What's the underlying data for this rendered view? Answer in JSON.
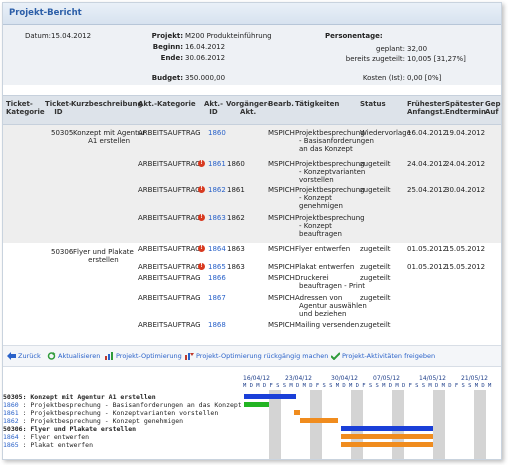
{
  "window": {
    "title": "Projekt-Bericht"
  },
  "summary": {
    "datum_label": "Datum:",
    "datum_value": "15.04.2012",
    "projekt_label": "Projekt:",
    "projekt_value": "M200 Produkteinführung",
    "beginn_label": "Beginn:",
    "beginn_value": "16.04.2012",
    "ende_label": "Ende:",
    "ende_value": "30.06.2012",
    "budget_label": "Budget:",
    "budget_value": "350.000,00",
    "personentage_label": "Personentage:",
    "geplant_label": "geplant:",
    "geplant_value": "32,00",
    "zugeteilt_label": "bereits zugeteilt:",
    "zugeteilt_value": "10,005 [31,27%]",
    "kosten_label": "Kosten (Ist):",
    "kosten_value": "0,00 [0%]"
  },
  "table": {
    "headers": {
      "ticket_kategorie_1": "Ticket-",
      "ticket_kategorie_2": "Kategorie",
      "ticket_id_1": "Ticket-",
      "ticket_id_2": "ID",
      "kurzbeschreibung": "Kurzbeschreibung",
      "akt_kategorie": "Akt.-Kategorie",
      "akt_id_1": "Akt.-",
      "akt_id_2": "ID",
      "vorgaenger_1": "Vorgänger-",
      "vorgaenger_2": "Akt.",
      "bearb": "Bearb.",
      "taetigkeiten": "Tätigkeiten",
      "status": "Status",
      "fruehester_1": "Frühester",
      "fruehester_2": "Anfangst.",
      "spaetester_1": "Spätester",
      "spaetester_2": "Endtermin",
      "gep_1": "Gep",
      "gep_2": "Auf"
    },
    "tickets": [
      {
        "id": "50305",
        "desc_1": "Konzept mit Agentur",
        "desc_2": "A1 erstellen"
      },
      {
        "id": "50306",
        "desc_1": "Flyer und Plakate",
        "desc_2": "erstellen"
      }
    ],
    "rows": [
      {
        "kat": "ARBEITSAUFTRAG",
        "warn": false,
        "akt": "1860",
        "vor": "",
        "bearb": "MSPICH",
        "t1": "Projektbesprechung",
        "t2": "- Basisanforderungen",
        "t3": "an das Konzept",
        "status": "Wiedervorlage",
        "start": "16.04.2012",
        "end": "19.04.2012"
      },
      {
        "kat": "ARBEITSAUFTRAG",
        "warn": true,
        "akt": "1861",
        "vor": "1860",
        "bearb": "MSPICH",
        "t1": "Projektbesprechung",
        "t2": "- Konzeptvarianten",
        "t3": "vorstellen",
        "status": "zugeteilt",
        "start": "24.04.2012",
        "end": "24.04.2012"
      },
      {
        "kat": "ARBEITSAUFTRAG",
        "warn": true,
        "akt": "1862",
        "vor": "1861",
        "bearb": "MSPICH",
        "t1": "Projektbesprechung",
        "t2": "- Konzept",
        "t3": "genehmigen",
        "status": "zugeteilt",
        "start": "25.04.2012",
        "end": "30.04.2012"
      },
      {
        "kat": "ARBEITSAUFTRAG",
        "warn": true,
        "akt": "1863",
        "vor": "1862",
        "bearb": "MSPICH",
        "t1": "Projektbesprechung",
        "t2": "- Konzept",
        "t3": "beauftragen",
        "status": "",
        "start": "",
        "end": ""
      },
      {
        "kat": "ARBEITSAUFTRAG",
        "warn": true,
        "akt": "1864",
        "vor": "1863",
        "bearb": "MSPICH",
        "t1": "Flyer entwerfen",
        "t2": "",
        "t3": "",
        "status": "zugeteilt",
        "start": "01.05.2012",
        "end": "15.05.2012"
      },
      {
        "kat": "ARBEITSAUFTRAG",
        "warn": true,
        "akt": "1865",
        "vor": "1863",
        "bearb": "MSPICH",
        "t1": "Plakat entwerfen",
        "t2": "",
        "t3": "",
        "status": "zugeteilt",
        "start": "01.05.2012",
        "end": "15.05.2012"
      },
      {
        "kat": "ARBEITSAUFTRAG",
        "warn": false,
        "akt": "1866",
        "vor": "",
        "bearb": "MSPICH",
        "t1": "Druckerei",
        "t2": "beauftragen - Print",
        "t3": "",
        "status": "zugeteilt",
        "start": "",
        "end": ""
      },
      {
        "kat": "ARBEITSAUFTRAG",
        "warn": false,
        "akt": "1867",
        "vor": "",
        "bearb": "MSPICH",
        "t1": "Adressen von",
        "t2": "Agentur auswählen",
        "t3": "und beziehen",
        "status": "zugeteilt",
        "start": "",
        "end": ""
      },
      {
        "kat": "ARBEITSAUFTRAG",
        "warn": false,
        "akt": "1868",
        "vor": "",
        "bearb": "MSPICH",
        "t1": "Mailing versenden",
        "t2": "",
        "t3": "",
        "status": "zugeteilt",
        "start": "",
        "end": ""
      }
    ]
  },
  "toolbar": {
    "zurueck": "Zurück",
    "aktualisieren": "Aktualisieren",
    "optimierung": "Projekt-Optimierung",
    "optimierung_undo": "Projekt-Optimierung rückgängig machen",
    "freigeben": "Projekt-Aktivitäten freigeben"
  },
  "gantt": {
    "dates": [
      "16/04/12",
      "23/04/12",
      "30/04/12",
      "07/05/12",
      "14/05/12",
      "21/05/12"
    ],
    "days": "M D M D F S S M D M D F S S M D M D F S S M D M D F S S M D M D F S S M D M",
    "rows": [
      {
        "text": "50305: Konzept mit Agentur A1 erstellen",
        "bold": true,
        "link": false
      },
      {
        "text": "1860 : Projektbesprechung - Basisanforderungen an das Konzept",
        "bold": false,
        "link": true,
        "id": "1860",
        "rest": " : Projektbesprechung - Basisanforderungen an das Konzept"
      },
      {
        "text": "1861 : Projektbesprechung - Konzeptvarianten vorstellen",
        "bold": false,
        "link": true,
        "id": "1861",
        "rest": " : Projektbesprechung - Konzeptvarianten vorstellen"
      },
      {
        "text": "1862 : Projektbesprechung - Konzept genehmigen",
        "bold": false,
        "link": true,
        "id": "1862",
        "rest": " : Projektbesprechung - Konzept genehmigen"
      },
      {
        "text": "50306: Flyer und Plakate erstellen",
        "bold": true,
        "link": false
      },
      {
        "text": "1864 : Flyer entwerfen",
        "bold": false,
        "link": true,
        "id": "1864",
        "rest": " : Flyer entwerfen"
      },
      {
        "text": "1865 : Plakat entwerfen",
        "bold": false,
        "link": true,
        "id": "1865",
        "rest": " : Plakat entwerfen"
      }
    ],
    "colors": {
      "summary": "#1a3fd8",
      "done": "#22b422",
      "planned": "#f08c1e",
      "weekend": "#d4d4d4"
    }
  }
}
